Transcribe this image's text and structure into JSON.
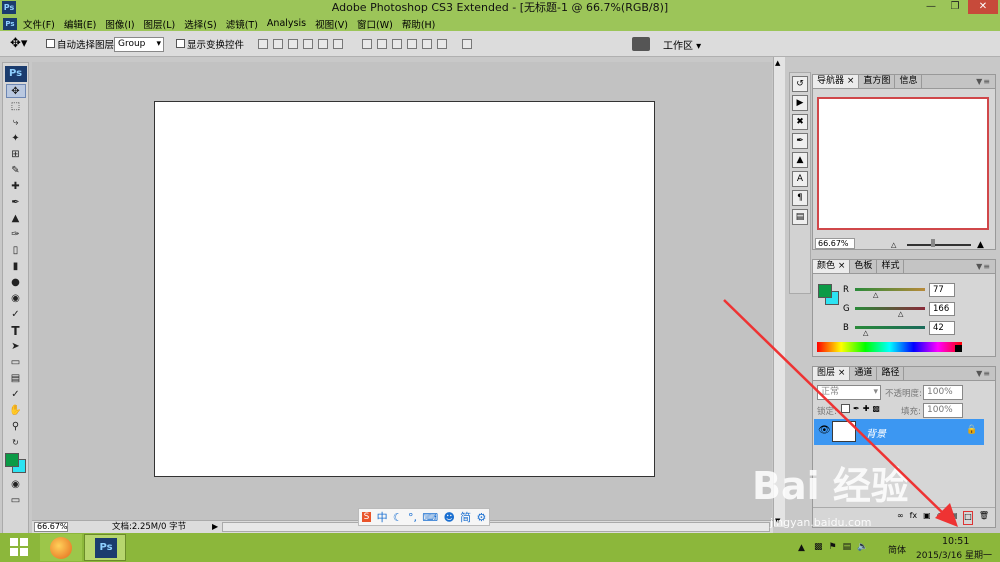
{
  "window": {
    "title": "Adobe Photoshop CS3 Extended - [无标题-1 @ 66.7%(RGB/8)]",
    "app_icon": "Ps",
    "controls": [
      "minimize",
      "restore",
      "close"
    ]
  },
  "menu": {
    "app_icon": "Ps",
    "items": [
      "文件(F)",
      "编辑(E)",
      "图像(I)",
      "图层(L)",
      "选择(S)",
      "滤镜(T)",
      "Analysis",
      "视图(V)",
      "窗口(W)",
      "帮助(H)"
    ]
  },
  "options": {
    "auto_select_label": "自动选择图层",
    "auto_select_value": "Group",
    "show_transform_label": "显示变换控件",
    "workspace_label": "工作区 ▾"
  },
  "tools": {
    "logo": "Ps",
    "items": [
      "move",
      "marquee",
      "lasso",
      "magic-wand",
      "crop",
      "slice",
      "healing",
      "brush",
      "stamp",
      "history-brush",
      "eraser",
      "gradient",
      "blur",
      "dodge",
      "pen",
      "type",
      "path-select",
      "shape",
      "notes",
      "eyedropper",
      "hand",
      "zoom",
      "swap",
      "color",
      "quick-mask",
      "screen-mode"
    ],
    "type_glyph": "T"
  },
  "status": {
    "zoom": "66.67%",
    "doc_info": "文档:2.25M/0 字节"
  },
  "navigator": {
    "tabs": [
      "导航器",
      "直方图",
      "信息"
    ],
    "zoom": "66.67%"
  },
  "color_panel": {
    "tabs": [
      "颜色",
      "色板",
      "样式"
    ],
    "channels": [
      {
        "label": "R",
        "value": "77",
        "fraction": 0.3
      },
      {
        "label": "G",
        "value": "166",
        "fraction": 0.65
      },
      {
        "label": "B",
        "value": "42",
        "fraction": 0.16
      }
    ],
    "foreground": "#0b9a46",
    "background": "#2de3f2"
  },
  "layers_panel": {
    "tabs": [
      "图层",
      "通道",
      "路径"
    ],
    "blend_mode": "正常",
    "opacity_label": "不透明度:",
    "opacity_value": "100%",
    "lock_label": "锁定:",
    "fill_label": "填充:",
    "fill_value": "100%",
    "layers": [
      {
        "name": "背景",
        "visible": true,
        "locked": true
      }
    ]
  },
  "ime": {
    "items": [
      "中",
      "简"
    ]
  },
  "taskbar": {
    "tray_lang": "简体",
    "time": "10:51",
    "date": "2015/3/16 星期一"
  },
  "watermark": {
    "text": "Bai 经验",
    "sub": "jingyan.baidu.com"
  }
}
